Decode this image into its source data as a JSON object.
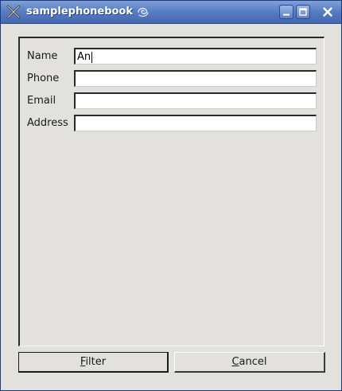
{
  "window": {
    "title": "samplephonebook",
    "icons": {
      "app": "x-cross-icon",
      "decoration": "swirl-icon",
      "minimize": "minimize-icon",
      "maximize": "maximize-icon",
      "close": "close-icon"
    },
    "colors": {
      "titlebar": "#5a7fc4",
      "body": "#e3e1de",
      "title_text": "#ffffff"
    }
  },
  "form": {
    "fields": [
      {
        "label": "Name",
        "value": "An",
        "placeholder": ""
      },
      {
        "label": "Phone",
        "value": "",
        "placeholder": ""
      },
      {
        "label": "Email",
        "value": "",
        "placeholder": ""
      },
      {
        "label": "Address",
        "value": "",
        "placeholder": ""
      }
    ]
  },
  "buttons": {
    "filter": {
      "mnemonic": "F",
      "rest": "ilter"
    },
    "cancel": {
      "mnemonic": "C",
      "rest": "ancel"
    }
  }
}
